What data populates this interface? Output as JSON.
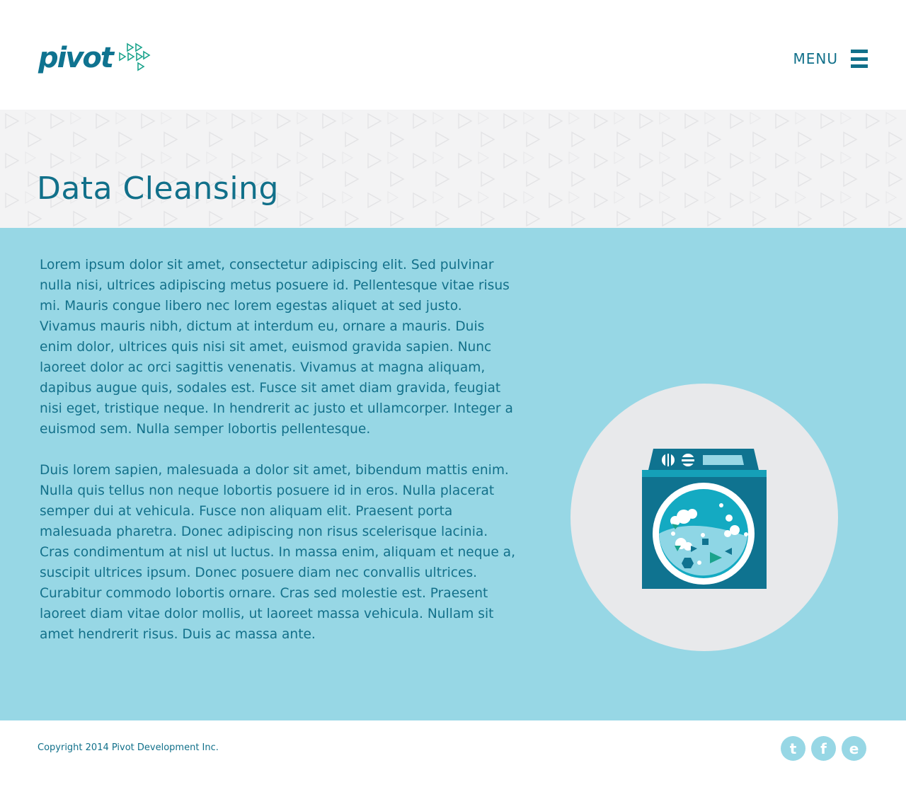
{
  "brand": {
    "name": "pivot",
    "primary_color": "#11708a",
    "accent_color": "#1aa38c"
  },
  "header": {
    "menu_label": "MENU",
    "menu_icon": "hamburger-icon"
  },
  "page": {
    "title": "Data Cleansing"
  },
  "content": {
    "paragraphs": [
      "Lorem ipsum dolor sit amet, consectetur adipiscing elit. Sed pulvinar nulla nisi, ultrices adipiscing metus posuere id. Pellentesque vitae risus mi. Mauris congue libero nec lorem egestas aliquet at sed justo. Vivamus mauris nibh, dictum at interdum eu, ornare a mauris. Duis enim dolor, ultrices quis nisi sit amet, euismod gravida sapien. Nunc laoreet dolor ac orci sagittis venenatis. Vivamus at magna aliquam, dapibus augue quis, sodales est. Fusce sit amet diam gravida, feugiat nisi eget, tristique neque. In hendrerit ac justo et ullamcorper. Integer a euismod sem. Nulla semper lobortis pellentesque.",
      "Duis lorem sapien, malesuada a dolor sit amet, bibendum mattis enim. Nulla quis tellus non neque lobortis posuere id in eros. Nulla placerat semper dui at vehicula. Fusce non aliquam elit. Praesent porta malesuada pharetra. Donec adipiscing non risus scelerisque lacinia. Cras condimentum at nisl ut luctus. In massa enim, aliquam et neque a, suscipit ultrices ipsum. Donec posuere diam nec convallis ultrices. Curabitur commodo lobortis ornare. Cras sed molestie est. Praesent laoreet diam vitae dolor mollis, ut laoreet massa vehicula. Nullam sit amet hendrerit risus. Duis ac massa ante."
    ],
    "illustration_icon": "washing-machine-icon"
  },
  "footer": {
    "copyright": "Copyright 2014 Pivot Development Inc.",
    "social": [
      {
        "icon": "twitter-icon",
        "glyph": "t"
      },
      {
        "icon": "facebook-icon",
        "glyph": "f"
      },
      {
        "icon": "email-icon",
        "glyph": "e"
      }
    ]
  },
  "colors": {
    "hero_bg": "#f3f3f4",
    "main_bg": "#97d7e5",
    "circle_bg": "#e8e9eb",
    "machine": "#0f7390"
  }
}
